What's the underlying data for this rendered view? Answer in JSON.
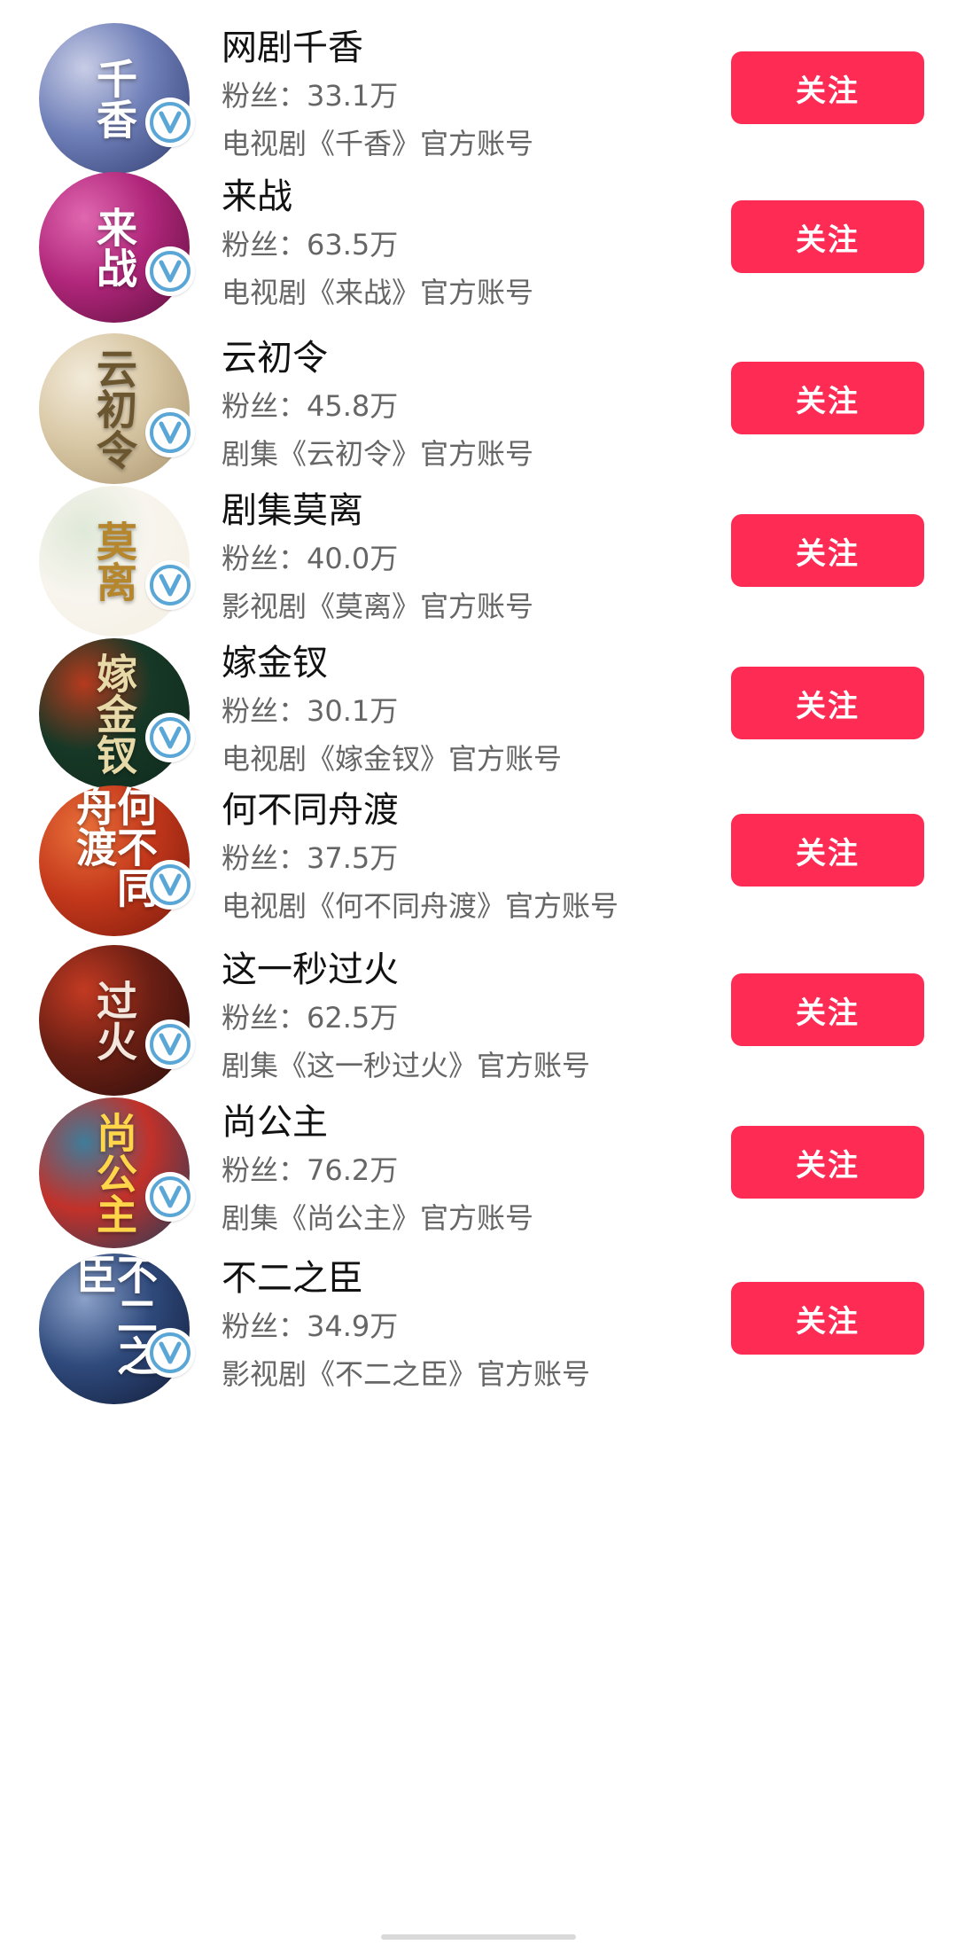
{
  "accounts": [
    {
      "name": "网剧千香",
      "fans": "粉丝：33.1万",
      "desc": "电视剧《千香》官方账号",
      "follow_label": "关注",
      "avatar_text": "千香",
      "avatar_colors": [
        "#2e3b6e",
        "#6f7fb8",
        "#c8cde6"
      ],
      "avatar_text_color": "#ffffff"
    },
    {
      "name": "来战",
      "fans": "粉丝：63.5万",
      "desc": "电视剧《来战》官方账号",
      "follow_label": "关注",
      "avatar_text": "来战",
      "avatar_colors": [
        "#5a0f3c",
        "#b0267a",
        "#e067b0"
      ],
      "avatar_text_color": "#ffffff"
    },
    {
      "name": "云初令",
      "fans": "粉丝：45.8万",
      "desc": "剧集《云初令》官方账号",
      "follow_label": "关注",
      "avatar_text": "云初令",
      "avatar_colors": [
        "#a8926c",
        "#d8c7a4",
        "#f2ead9"
      ],
      "avatar_text_color": "#6b5630"
    },
    {
      "name": "剧集莫离",
      "fans": "粉丝：40.0万",
      "desc": "影视剧《莫离》官方账号",
      "follow_label": "关注",
      "avatar_text": "莫离",
      "avatar_colors": [
        "#f4efe2",
        "#f8f5ee",
        "#dfe9d9"
      ],
      "avatar_text_color": "#b5862c"
    },
    {
      "name": "嫁金钗",
      "fans": "粉丝：30.1万",
      "desc": "电视剧《嫁金钗》官方账号",
      "follow_label": "关注",
      "avatar_text": "嫁金钗",
      "avatar_colors": [
        "#0f2a1d",
        "#173826",
        "#b53a1e"
      ],
      "avatar_text_color": "#e8d9a8"
    },
    {
      "name": "何不同舟渡",
      "fans": "粉丝：37.5万",
      "desc": "电视剧《何不同舟渡》官方账号",
      "follow_label": "关注",
      "avatar_text": "何不同舟渡",
      "avatar_colors": [
        "#7a1a0c",
        "#c4381b",
        "#e8703a"
      ],
      "avatar_text_color": "#ffffff"
    },
    {
      "name": "这一秒过火",
      "fans": "粉丝：62.5万",
      "desc": "剧集《这一秒过火》官方账号",
      "follow_label": "关注",
      "avatar_text": "过火",
      "avatar_colors": [
        "#2a0e0b",
        "#6b1f14",
        "#c23a22"
      ],
      "avatar_text_color": "#f3e6dc"
    },
    {
      "name": "尚公主",
      "fans": "粉丝：76.2万",
      "desc": "剧集《尚公主》官方账号",
      "follow_label": "关注",
      "avatar_text": "尚公主",
      "avatar_colors": [
        "#1c3d5c",
        "#c2312a",
        "#3f7c9a"
      ],
      "avatar_text_color": "#ffd54a"
    },
    {
      "name": "不二之臣",
      "fans": "粉丝：34.9万",
      "desc": "影视剧《不二之臣》官方账号",
      "follow_label": "关注",
      "avatar_text": "不二之臣",
      "avatar_colors": [
        "#101a35",
        "#2f4a7c",
        "#8aa0c8"
      ],
      "avatar_text_color": "#ffffff"
    }
  ],
  "badge": {
    "icon": "verified-v-icon",
    "color": "#5aa6d6"
  },
  "accent": "#fe2c55"
}
